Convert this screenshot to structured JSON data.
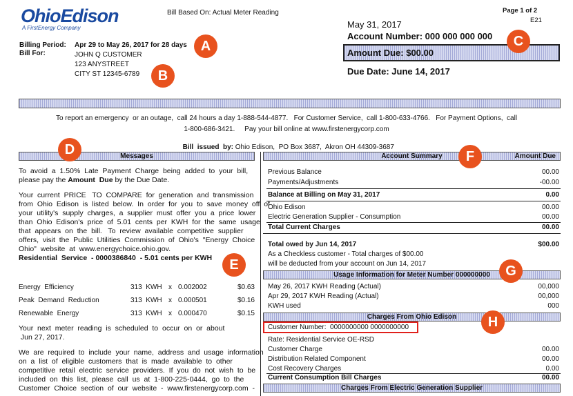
{
  "header": {
    "logo_text": "OhioEdison",
    "logo_tagline": "A FirstEnergy Company",
    "bill_based_on": "Bill Based On:  Actual Meter Reading",
    "page": "Page 1 of 2",
    "code": "E21",
    "billing_period_label": "Billing Period:",
    "billing_period_value": "Apr 29 to May 26, 2017 for 28 days",
    "bill_for_label": "Bill For:",
    "customer_name": "JOHN Q CUSTOMER",
    "street": "123 ANYSTREET",
    "city": "CITY ST 12345-6789",
    "date": "May 31, 2017",
    "account_number": "Account Number: 000 000 000 000",
    "amount_due": "Amount Due:  $00.00",
    "due_date": "Due Date:  June 14, 2017"
  },
  "badges": {
    "a": "A",
    "b": "B",
    "c": "C",
    "d": "D",
    "e": "E",
    "f": "F",
    "g": "G",
    "h": "H"
  },
  "contact": {
    "line1": "To report an emergency  or an outage,  call 24 hours a day 1-888-544-4877.   For Customer Service,  call 1-800-633-4766.   For Payment Options,  call",
    "line2": "1-800-686-3421.     Pay your bill online at www.firstenergycorp.com",
    "line3_label": "Bill  issued  by:",
    "line3_value": " Ohio Edison,  PO Box 3687,  Akron OH 44309-3687"
  },
  "messages": {
    "header": "Messages",
    "p1a": "To  avoid  a  1.50%  Late  Payment  Charge  being  added  to  your  bill,",
    "p1b": "please pay the ",
    "p1b_bold": "Amount  Due",
    "p1b_end": " by the Due Date.",
    "p2_lines": [
      "Your  current  PRICE   TO  COMPARE  for  generation  and  transmission",
      "from  Ohio  Edison  is  listed  below.  In  order  for  you  to  save  money  off  of",
      "your  utility's  supply  charges,  a  supplier  must  offer  you  a  price  lower",
      "than  Ohio  Edison's  price  of  5.01  cents  per  KWH  for  the  same  usage",
      "that  appears  on  the  bill.   To  review  available  competitive  supplier",
      "offers,  visit  the  Public  Utilities  Commission  of  Ohio's  \"Energy  Choice",
      "Ohio\"  website  at  www.energychoice.ohio.gov."
    ],
    "residential": "Residential  Service  - 0000386840  - 5.01 cents per KWH",
    "charges": [
      {
        "label": "Energy  Efficiency",
        "kwh": "313  KWH",
        "x": "x",
        "rate": "0.002002",
        "amount": "$0.63"
      },
      {
        "label": "Peak  Demand  Reduction",
        "kwh": "313  KWH",
        "x": "x",
        "rate": "0.000501",
        "amount": "$0.16"
      },
      {
        "label": "Renewable  Energy",
        "kwh": "313  KWH",
        "x": "x",
        "rate": "0.000470",
        "amount": "$0.15"
      }
    ],
    "p3_lines": [
      "Your  next  meter  reading  is  scheduled  to  occur  on  or  about",
      " Jun 27, 2017."
    ],
    "p4_lines": [
      "We  are  required  to  include  your  name,  address  and  usage  information",
      "on  a  list  of  eligible  customers  that  is  made  available  to  other",
      "competitive  retail  electric  service  providers.  If  you  do  not  wish  to  be",
      "included  on  this  list,  please  call  us  at  1-800-225-0444,  go  to  the",
      "Customer  Choice  section  of  our  website  -  www.firstenergycorp.com  -"
    ]
  },
  "account_summary": {
    "header": "Account Summary",
    "amount_due_header": "Amount Due",
    "previous_balance": "Previous Balance",
    "previous_balance_value": "00.00",
    "payments": "Payments/Adjustments",
    "payments_value": "-00.00",
    "balance": "Balance at Billing on May 31, 2017",
    "balance_value": "0.00",
    "ohio_edison": "Ohio Edison",
    "ohio_edison_value": "00.00",
    "egs": "Electric Generation Supplier - Consumption",
    "egs_value": "00.00",
    "total_current": "Total Current Charges",
    "total_current_value": "00.00",
    "total_owed": "Total owed by Jun 14, 2017",
    "total_owed_value": "$00.00",
    "checkless1": "As a Checkless customer - Total charges of $00.00",
    "checkless2": "will be deducted from your account on Jun 14, 2017"
  },
  "usage": {
    "header": "Usage Information for Meter Number  000000000",
    "reading1": "May 26, 2017 KWH Reading (Actual)",
    "reading1_value": "00,000",
    "reading2": "Apr 29, 2017 KWH Reading (Actual)",
    "reading2_value": "00,000",
    "kwh_used": "KWH used",
    "kwh_used_value": "000"
  },
  "charges_oe": {
    "header": "Charges From Ohio Edison",
    "customer_number": "Customer Number:  0000000000 0000000000",
    "rate": "Rate:  Residential Service OE-RSD",
    "customer_charge": "Customer Charge",
    "customer_charge_value": "00.00",
    "distribution": "Distribution Related Component",
    "distribution_value": "00.00",
    "cost_recovery": "Cost Recovery Charges",
    "cost_recovery_value": "0.00",
    "current_consumption": "Current Consumption Bill Charges",
    "current_consumption_value": "00.00"
  },
  "charges_egs": {
    "header": "Charges From Electric Generation Supplier"
  },
  "colors": {
    "badge": "#e8521e",
    "logo_blue": "#1a4aa0",
    "highlight_box": "#e0201b"
  }
}
